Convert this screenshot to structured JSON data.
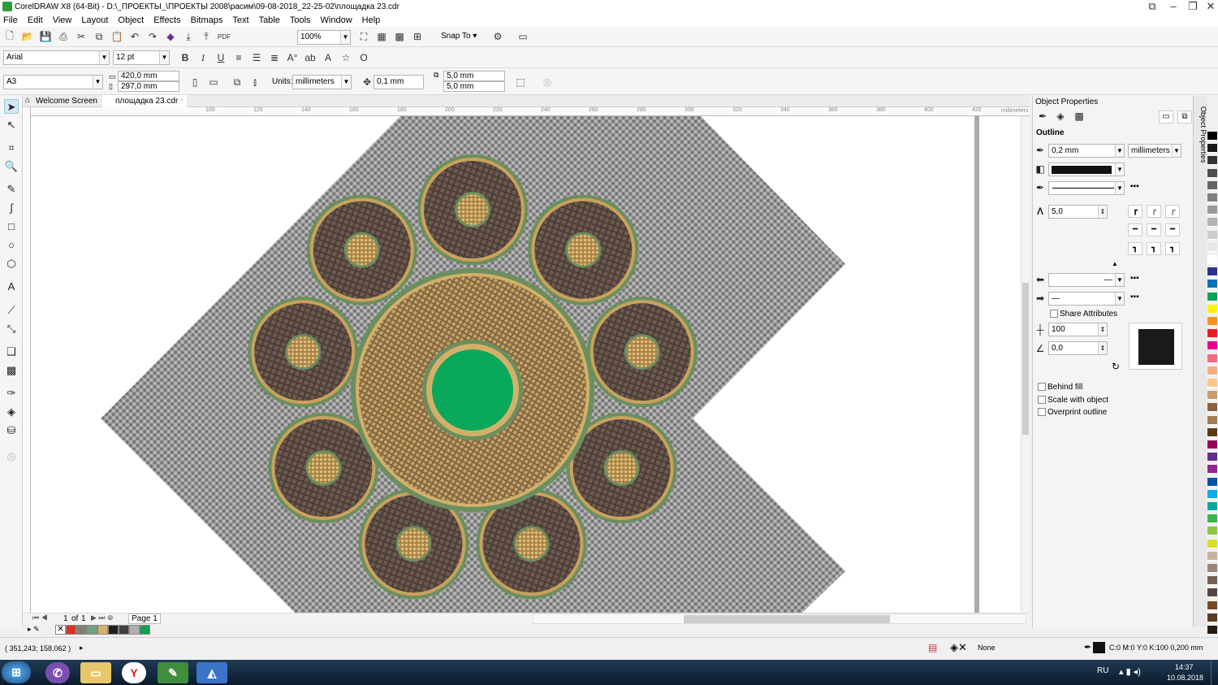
{
  "window": {
    "title": "CorelDRAW X8 (64-Bit) - D:\\_ПРОЕКТЫ_\\ПРОЕКТЫ 2008\\расим\\09-08-2018_22-25-02\\площадка 23.cdr"
  },
  "menu": [
    "File",
    "Edit",
    "View",
    "Layout",
    "Object",
    "Effects",
    "Bitmaps",
    "Text",
    "Table",
    "Tools",
    "Window",
    "Help"
  ],
  "standard_toolbar": {
    "zoom": "100%",
    "snap_to": "Snap To"
  },
  "text_toolbar": {
    "font": "Arial",
    "size": "12 pt"
  },
  "property_bar": {
    "page_size": "A3",
    "width": "420,0 mm",
    "height": "297,0 mm",
    "units_label": "Units:",
    "units": "millimeters",
    "nudge": "0,1 mm",
    "dup_x": "5,0 mm",
    "dup_y": "5,0 mm"
  },
  "doc_tabs": [
    "Welcome Screen",
    "площадка 23.cdr"
  ],
  "ruler": {
    "top_ticks": [
      "100",
      "120",
      "140",
      "160",
      "180",
      "200",
      "220",
      "240",
      "260",
      "280",
      "300",
      "320",
      "340",
      "360",
      "380",
      "400",
      "420"
    ],
    "unit": "millimeters"
  },
  "page_nav": {
    "current": "1",
    "of": "of",
    "total": "1",
    "page_tab": "Page 1"
  },
  "bottom_palette": [
    "#e03020",
    "#808070",
    "#70a080",
    "#d8b070",
    "#202020",
    "#404040",
    "#b0b0b0",
    "#10a050"
  ],
  "right_palette": [
    "#000000",
    "#1a1a1a",
    "#333333",
    "#4d4d4d",
    "#666666",
    "#808080",
    "#999999",
    "#b3b3b3",
    "#cccccc",
    "#e6e6e6",
    "#ffffff",
    "#2e3192",
    "#0071bc",
    "#00a651",
    "#fff200",
    "#f7941d",
    "#ed1c24",
    "#ec008c",
    "#f26d7d",
    "#f9ad81",
    "#fdc689",
    "#c69c6d",
    "#8c6239",
    "#a67c52",
    "#603913",
    "#9e005d",
    "#662d91",
    "#92278f",
    "#0054a6",
    "#00aeef",
    "#00a99d",
    "#39b54a",
    "#8dc63f",
    "#d7df23",
    "#c7b299",
    "#998675",
    "#736357",
    "#534741",
    "#754c24",
    "#5c3c1e",
    "#2b1b0e"
  ],
  "document_colors": {
    "background_weave": "#8a8a8a",
    "petal_dark": "#5a4a42",
    "petal_center": "#c9a25c",
    "outer_ring": "#6b8f5e",
    "center_fill": "#0aa85a"
  },
  "object_properties": {
    "header": "Object Properties",
    "outline_label": "Outline",
    "width": "0,2 mm",
    "units": "millimeters",
    "color": "#111111",
    "miter": "5,0",
    "stretch": "100",
    "angle": "0,0",
    "share_attributes": "Share Attributes",
    "behind_fill": "Behind fill",
    "scale_with_object": "Scale with object",
    "overprint_outline": "Overprint outline",
    "side_tab": "Object Properties"
  },
  "status": {
    "coords": "( 351,243; 158,062 )",
    "fill_label": "None",
    "outline_info": "C:0 M:0 Y:0 K:100  0,200 mm"
  },
  "taskbar": {
    "lang": "RU",
    "time": "14:37",
    "date": "10.08.2018"
  }
}
